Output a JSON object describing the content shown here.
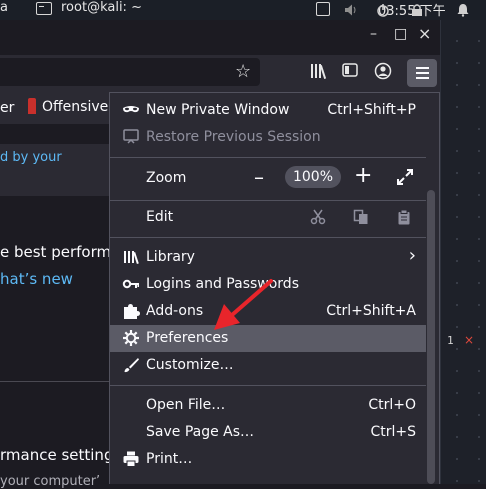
{
  "system_panel": {
    "left_fragment": "a",
    "terminal_title": "root@kali: ~",
    "clock": "03:55 下午"
  },
  "window_controls": {
    "minimize": "–",
    "maximize": "□",
    "close": "×"
  },
  "bookmarks": {
    "item1": "er",
    "item2": "Offensive"
  },
  "page": {
    "link1": "d by your",
    "text1": "e best performa",
    "link2": "hat’s new",
    "text2": "rmance settings",
    "text3": "your computer’"
  },
  "editor_panel": {
    "line_number": "1",
    "error_mark": "×"
  },
  "menu": {
    "new_private_window": {
      "label": "New Private Window",
      "shortcut": "Ctrl+Shift+P"
    },
    "restore_session": {
      "label": "Restore Previous Session"
    },
    "zoom": {
      "label": "Zoom",
      "minus": "–",
      "value": "100%",
      "plus": "+"
    },
    "edit": {
      "label": "Edit"
    },
    "library": {
      "label": "Library",
      "chevron": "›"
    },
    "logins": {
      "label": "Logins and Passwords"
    },
    "addons": {
      "label": "Add-ons",
      "shortcut": "Ctrl+Shift+A"
    },
    "preferences": {
      "label": "Preferences"
    },
    "customize": {
      "label": "Customize…"
    },
    "open_file": {
      "label": "Open File…",
      "shortcut": "Ctrl+O"
    },
    "save_page": {
      "label": "Save Page As…",
      "shortcut": "Ctrl+S"
    },
    "print": {
      "label": "Print…"
    }
  },
  "colors": {
    "accent_arrow": "#e8252b",
    "menu_bg": "#2b2a33",
    "highlight": "#5b5b66",
    "link": "#5db9f5"
  },
  "icons": [
    "terminal-icon",
    "bookmark-star-icon",
    "library-icon",
    "sidebar-icon",
    "account-icon",
    "hamburger-menu-icon",
    "mask-icon",
    "restore-icon",
    "fullscreen-icon",
    "cut-icon",
    "copy-icon",
    "paste-icon",
    "key-icon",
    "puzzle-icon",
    "gear-icon",
    "brush-icon",
    "printer-icon"
  ]
}
